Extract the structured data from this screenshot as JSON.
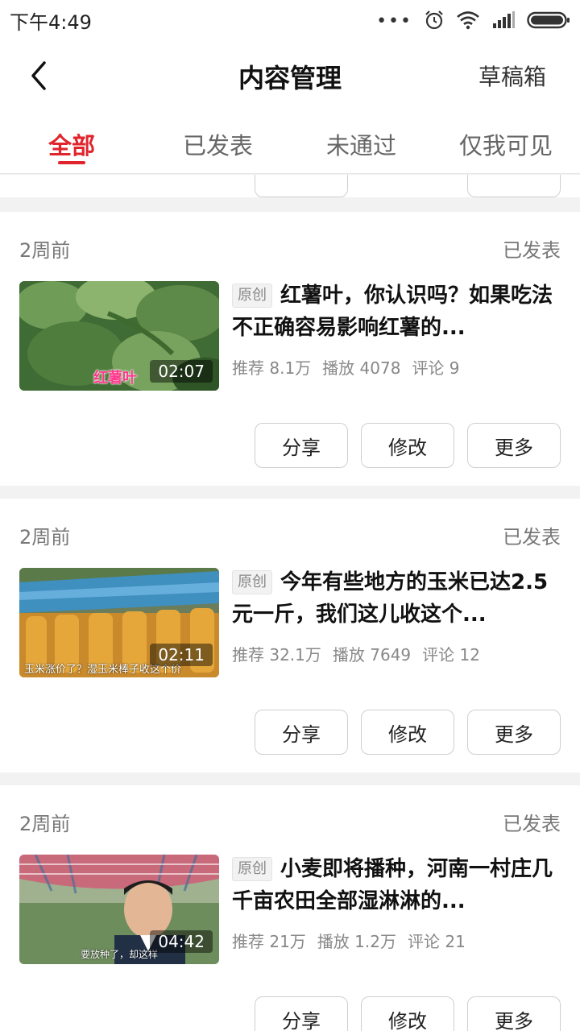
{
  "status_bar": {
    "time": "下午4:49",
    "icons": [
      "more-dots-icon",
      "alarm-icon",
      "wifi-icon",
      "signal-icon",
      "battery-icon"
    ]
  },
  "header": {
    "title": "内容管理",
    "drafts": "草稿箱",
    "back_icon": "chevron-left-icon"
  },
  "tabs": [
    {
      "label": "全部",
      "active": true
    },
    {
      "label": "已发表",
      "active": false
    },
    {
      "label": "未通过",
      "active": false
    },
    {
      "label": "仅我可见",
      "active": false
    }
  ],
  "accent_color": "#e0242c",
  "items": [
    {
      "time": "2周前",
      "status": "已发表",
      "badge": "原创",
      "title": "红薯叶，你认识吗？如果吃法不正确容易影响红薯的...",
      "duration": "02:07",
      "thumb_caption": "红薯叶",
      "stats": {
        "recommend": "推荐 8.1万",
        "play": "播放 4078",
        "comment": "评论 9"
      },
      "actions": {
        "share": "分享",
        "edit": "修改",
        "more": "更多"
      }
    },
    {
      "time": "2周前",
      "status": "已发表",
      "badge": "原创",
      "title": "今年有些地方的玉米已达2.5元一斤，我们这儿收这个...",
      "duration": "02:11",
      "thumb_caption": "玉米涨价了？湿玉米棒子收这个价",
      "stats": {
        "recommend": "推荐 32.1万",
        "play": "播放 7649",
        "comment": "评论 12"
      },
      "actions": {
        "share": "分享",
        "edit": "修改",
        "more": "更多"
      }
    },
    {
      "time": "2周前",
      "status": "已发表",
      "badge": "原创",
      "title": "小麦即将播种，河南一村庄几千亩农田全部湿淋淋的...",
      "duration": "04:42",
      "thumb_caption": "要放种了，却这样",
      "stats": {
        "recommend": "推荐 21万",
        "play": "播放 1.2万",
        "comment": "评论 21"
      },
      "actions": {
        "share": "分享",
        "edit": "修改",
        "more": "更多"
      }
    }
  ]
}
